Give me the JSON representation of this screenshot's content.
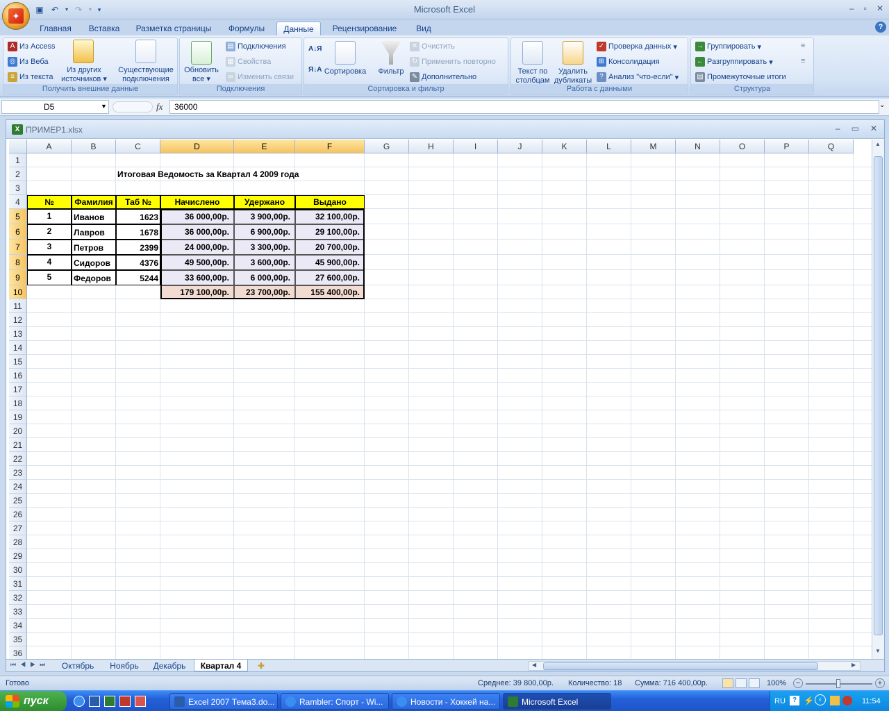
{
  "window": {
    "title": "Microsoft Excel"
  },
  "ribbon_tabs": [
    "Главная",
    "Вставка",
    "Разметка страницы",
    "Формулы",
    "Данные",
    "Рецензирование",
    "Вид"
  ],
  "active_tab": "Данные",
  "ribbon": {
    "g1": {
      "label": "Получить внешние данные",
      "access": "Из Access",
      "web": "Из Веба",
      "text": "Из текста",
      "other1": "Из других",
      "other2": "источников",
      "exist1": "Существующие",
      "exist2": "подключения"
    },
    "g2": {
      "label": "Подключения",
      "refresh1": "Обновить",
      "refresh2": "все",
      "conn": "Подключения",
      "props": "Свойства",
      "links": "Изменить связи"
    },
    "g3": {
      "label": "Сортировка и фильтр",
      "sort": "Сортировка",
      "filter": "Фильтр",
      "clear": "Очистить",
      "reapply": "Применить повторно",
      "advanced": "Дополнительно"
    },
    "g4": {
      "label": "Работа с данными",
      "ttc1": "Текст по",
      "ttc2": "столбцам",
      "dup1": "Удалить",
      "dup2": "дубликаты",
      "validate": "Проверка данных",
      "consolidate": "Консолидация",
      "whatif": "Анализ \"что-если\""
    },
    "g5": {
      "label": "Структура",
      "group": "Группировать",
      "ungroup": "Разгруппировать",
      "subtotal": "Промежуточные итоги"
    }
  },
  "formula_bar": {
    "name_box": "D5",
    "fx": "fx",
    "value": "36000"
  },
  "workbook": {
    "name": "ПРИМЕР1.xlsx"
  },
  "columns": [
    "A",
    "B",
    "C",
    "D",
    "E",
    "F",
    "G",
    "H",
    "I",
    "J",
    "K",
    "L",
    "M",
    "N",
    "O",
    "P",
    "Q"
  ],
  "rows": [
    "1",
    "2",
    "3",
    "4",
    "5",
    "6",
    "7",
    "8",
    "9",
    "10",
    "11",
    "12",
    "13",
    "14",
    "15",
    "16",
    "17",
    "18",
    "19",
    "20",
    "21",
    "22",
    "23",
    "24",
    "25",
    "26",
    "27",
    "28",
    "29",
    "30",
    "31",
    "32",
    "33",
    "34",
    "35",
    "36"
  ],
  "sheet": {
    "title": "Итоговая Ведомость за Квартал 4 2009 года",
    "headers": [
      "№",
      "Фамилия",
      "Таб №",
      "Начислено",
      "Удержано",
      "Выдано"
    ],
    "data": [
      [
        "1",
        "Иванов",
        "1623",
        "36 000,00р.",
        "3 900,00р.",
        "32 100,00р."
      ],
      [
        "2",
        "Лавров",
        "1678",
        "36 000,00р.",
        "6 900,00р.",
        "29 100,00р."
      ],
      [
        "3",
        "Петров",
        "2399",
        "24 000,00р.",
        "3 300,00р.",
        "20 700,00р."
      ],
      [
        "4",
        "Сидоров",
        "4376",
        "49 500,00р.",
        "3 600,00р.",
        "45 900,00р."
      ],
      [
        "5",
        "Федоров",
        "5244",
        "33 600,00р.",
        "6 000,00р.",
        "27 600,00р."
      ]
    ],
    "totals": [
      "179 100,00р.",
      "23 700,00р.",
      "155 400,00р."
    ]
  },
  "sheet_tabs": [
    "Октябрь",
    "Ноябрь",
    "Декабрь",
    "Квартал 4"
  ],
  "active_sheet": "Квартал 4",
  "status": {
    "ready": "Готово",
    "avg": "Среднее:  39 800,00р.",
    "count": "Количество: 18",
    "sum": "Сумма:  716 400,00р.",
    "zoom": "100%"
  },
  "taskbar": {
    "start": "пуск",
    "tasks": [
      "Excel 2007 Тема3.do...",
      "Rambler: Спорт - Wi...",
      "Новости - Хоккей на...",
      "Microsoft Excel"
    ],
    "lang": "RU",
    "clock": "11:54"
  }
}
